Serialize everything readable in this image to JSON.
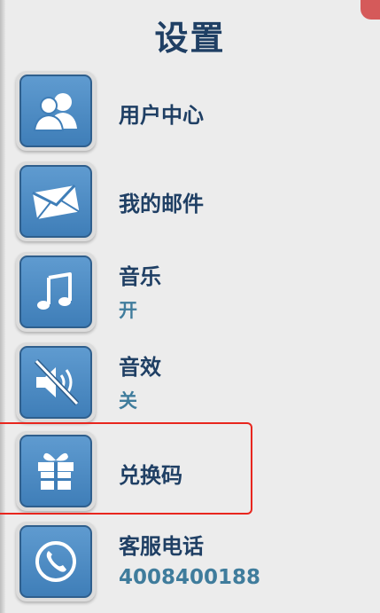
{
  "title": "设置",
  "items": {
    "user_center": {
      "label": "用户中心",
      "icon": "user-group-icon"
    },
    "my_mail": {
      "label": "我的邮件",
      "icon": "envelope-icon"
    },
    "music": {
      "label": "音乐",
      "status": "开",
      "icon": "music-note-icon"
    },
    "sound_fx": {
      "label": "音效",
      "status": "关",
      "icon": "speaker-muted-icon"
    },
    "redeem_code": {
      "label": "兑换码",
      "icon": "gift-icon"
    },
    "support_phone": {
      "label": "客服电话",
      "number": "4008400188",
      "icon": "phone-icon"
    }
  },
  "colors": {
    "title": "#1f3f64",
    "tile": "#4f8dc6",
    "status_text": "#3f7c9c",
    "highlight_border": "#e8261e"
  }
}
